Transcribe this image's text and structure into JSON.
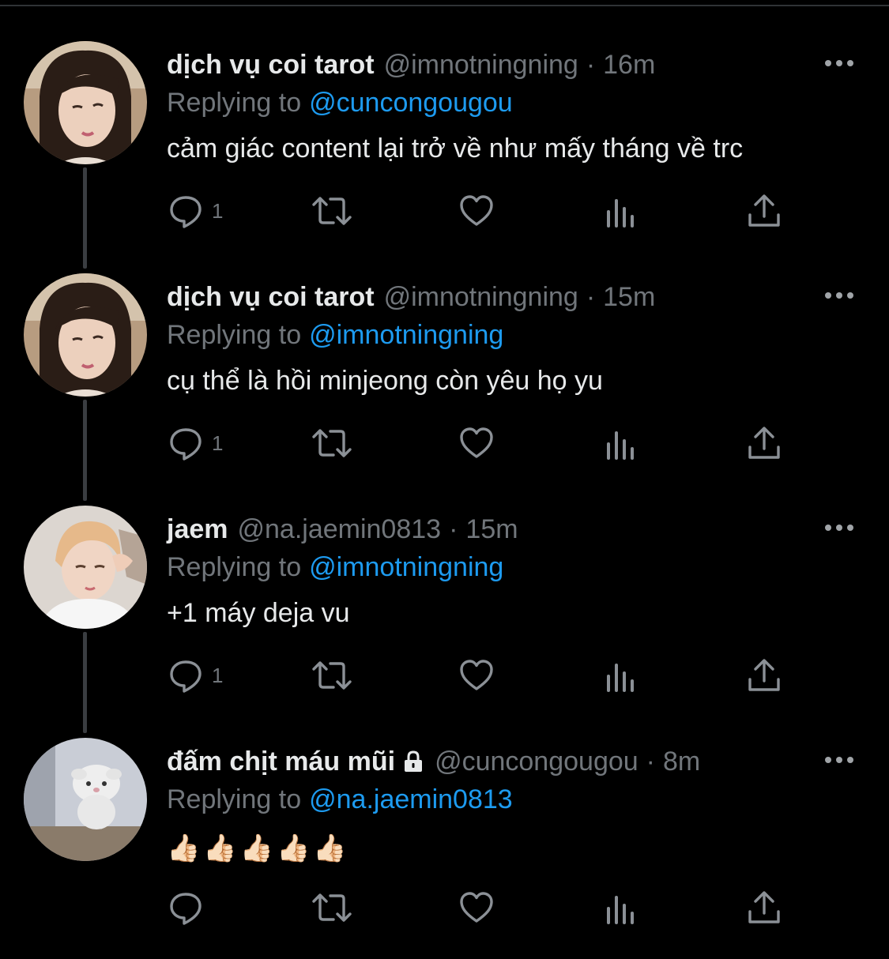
{
  "tweets": [
    {
      "name": "dịch vụ coi tarot",
      "handle": "@imnotningning",
      "dot": "·",
      "time": "16m",
      "replying_label": "Replying to",
      "replying_to": "@cuncongougou",
      "text": "cảm giác content lại trở về như mấy tháng về trc",
      "reply_count": "1",
      "avatar": "girl-dark-hair-avatar"
    },
    {
      "name": "dịch vụ coi tarot",
      "handle": "@imnotningning",
      "dot": "·",
      "time": "15m",
      "replying_label": "Replying to",
      "replying_to": "@imnotningning",
      "text": "cụ thể là hồi minjeong còn yêu họ yu",
      "reply_count": "1",
      "avatar": "girl-dark-hair-avatar"
    },
    {
      "name": "jaem",
      "handle": "@na.jaemin0813",
      "dot": "·",
      "time": "15m",
      "replying_label": "Replying to",
      "replying_to": "@imnotningning",
      "text": "+1 máy deja vu",
      "reply_count": "1",
      "avatar": "blond-boy-avatar"
    },
    {
      "name": "đấm chịt máu mũi",
      "handle": "@cuncongougou",
      "dot": "·",
      "time": "8m",
      "replying_label": "Replying to",
      "replying_to": "@na.jaemin0813",
      "text": "👍🏻👍🏻👍🏻👍🏻👍🏻",
      "reply_count": "",
      "avatar": "plush-toy-avatar",
      "locked": true
    }
  ],
  "icons": {
    "reply": "reply-icon",
    "retweet": "retweet-icon",
    "like": "heart-icon",
    "views": "views-icon",
    "share": "share-icon",
    "more": "more-icon",
    "lock": "lock-icon"
  },
  "colors": {
    "background": "#000000",
    "text": "#e7e9ea",
    "muted": "#71767b",
    "link": "#1d9bf0",
    "thread_line": "#3a3d41"
  }
}
